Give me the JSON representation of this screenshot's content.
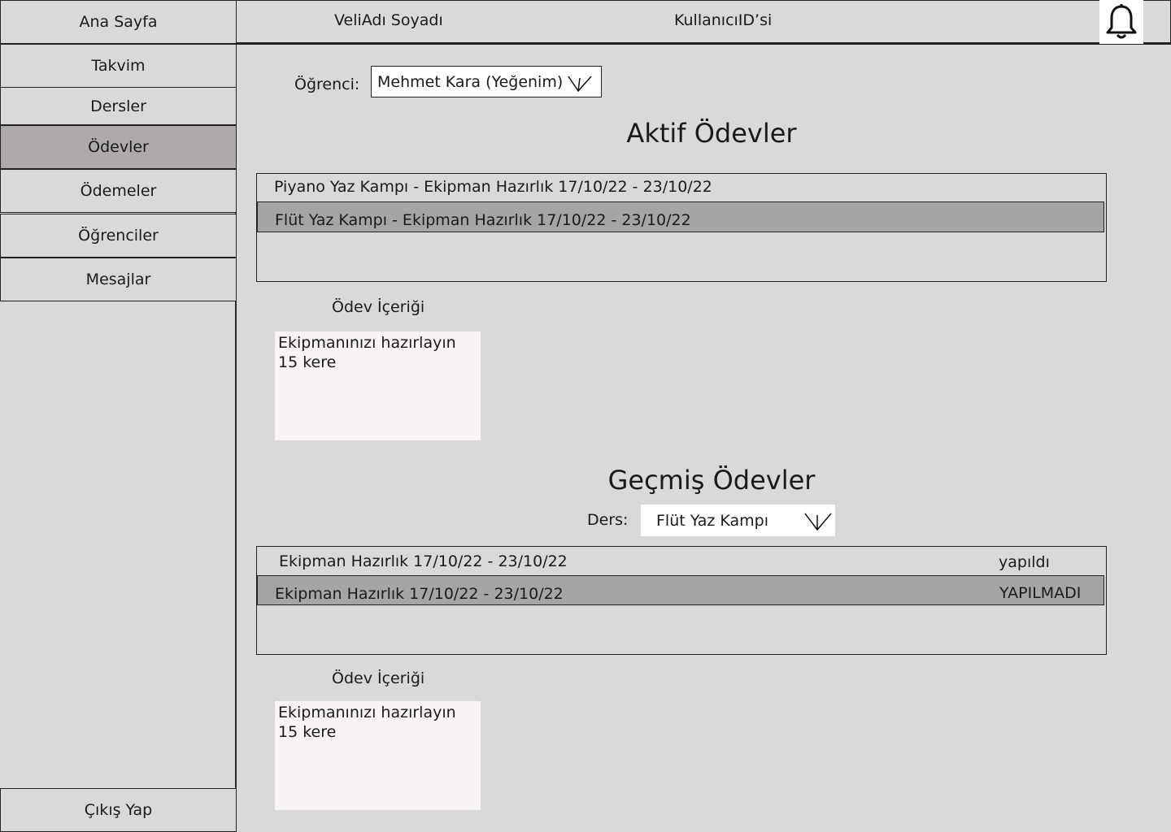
{
  "sidebar": {
    "home": "Ana Sayfa",
    "items": [
      {
        "label": "Takvim"
      },
      {
        "label": "Dersler"
      },
      {
        "label": "Ödevler"
      },
      {
        "label": "Ödemeler"
      },
      {
        "label": "Öğrenciler"
      },
      {
        "label": "Mesajlar"
      }
    ],
    "active_item": "Ödevler",
    "logout": "Çıkış Yap"
  },
  "topbar": {
    "parent_name": "VeliAdı Soyadı",
    "user_id": "KullanıcıID’si",
    "notification_icon": "bell-icon"
  },
  "student_filter": {
    "label": "Öğrenci:",
    "selected": "Mehmet Kara (Yeğenim)",
    "icon": "chevron-down-icon"
  },
  "active_homework": {
    "title": "Aktif Ödevler",
    "rows": [
      {
        "text": "Piyano Yaz Kampı - Ekipman Hazırlık 17/10/22 - 23/10/22",
        "selected": false
      },
      {
        "text": "Flüt Yaz Kampı - Ekipman Hazırlık 17/10/22 - 23/10/22",
        "selected": true
      }
    ],
    "content_label": "Ödev İçeriği",
    "content_text": "Ekipmanınızı hazırlayın 15 kere"
  },
  "past_homework": {
    "title": "Geçmiş Ödevler",
    "course_filter": {
      "label": "Ders:",
      "selected": "Flüt Yaz Kampı",
      "icon": "chevron-down-icon"
    },
    "rows": [
      {
        "text": "Ekipman Hazırlık 17/10/22 - 23/10/22",
        "status": "yapıldı",
        "selected": false
      },
      {
        "text": "Ekipman Hazırlık 17/10/22 - 23/10/22",
        "status": "YAPILMADI",
        "selected": true
      }
    ],
    "content_label": "Ödev İçeriği",
    "content_text": "Ekipmanınızı hazırlayın 15 kere"
  },
  "colors": {
    "background": "#d9d9d9",
    "active_nav": "#aeaaaa",
    "selected_row": "#a5a5a5",
    "content_box": "#f7f4f3"
  }
}
